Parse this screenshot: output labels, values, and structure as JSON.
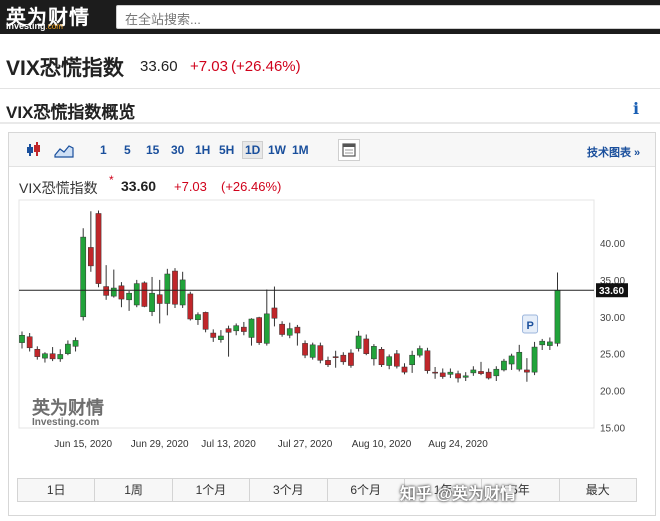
{
  "header": {
    "logo_cn": "英为财情",
    "logo_en": "Investing",
    "logo_en_suffix": ".com",
    "search_placeholder": "在全站搜索..."
  },
  "instrument": {
    "name": "VIX恐慌指数",
    "price": "33.60",
    "change": "+7.03",
    "change_pct": "(+26.46%)"
  },
  "section": {
    "title": "VIX恐慌指数概览",
    "info_icon": "i"
  },
  "toolbar": {
    "intervals": [
      "1",
      "5",
      "15",
      "30",
      "1H",
      "5H",
      "1D",
      "1W",
      "1M"
    ],
    "active_interval": "1D",
    "tech_chart_label": "技术图表 »"
  },
  "chart_header": {
    "name": "VIX恐慌指数",
    "star": "*",
    "price": "33.60",
    "change": "+7.03",
    "change_pct": "(+26.46%)"
  },
  "chart_data": {
    "type": "candlestick",
    "title": "VIX恐慌指数",
    "x_labels": [
      "Jun 15, 2020",
      "Jun 29, 2020",
      "Jul 13, 2020",
      "Jul 27, 2020",
      "Aug 10, 2020",
      "Aug 24, 2020"
    ],
    "y_ticks": [
      "15.00",
      "20.00",
      "25.00",
      "30.00",
      "35.00",
      "40.00"
    ],
    "ylim": [
      15,
      42
    ],
    "current_price_label": "33.60",
    "marker_label": "P",
    "up_color": "#21a33a",
    "down_color": "#c0262a",
    "candles": [
      {
        "date": "2020-06-03",
        "o": 26.5,
        "h": 28.0,
        "l": 25.7,
        "c": 27.5
      },
      {
        "date": "2020-06-04",
        "o": 27.3,
        "h": 27.8,
        "l": 25.3,
        "c": 25.8
      },
      {
        "date": "2020-06-05",
        "o": 25.6,
        "h": 26.0,
        "l": 24.2,
        "c": 24.6
      },
      {
        "date": "2020-06-08",
        "o": 24.4,
        "h": 25.2,
        "l": 23.8,
        "c": 25.0
      },
      {
        "date": "2020-06-09",
        "o": 25.0,
        "h": 25.9,
        "l": 24.0,
        "c": 24.3
      },
      {
        "date": "2020-06-10",
        "o": 24.3,
        "h": 25.6,
        "l": 23.9,
        "c": 24.9
      },
      {
        "date": "2020-06-11",
        "o": 25.0,
        "h": 26.8,
        "l": 24.8,
        "c": 26.3
      },
      {
        "date": "2020-06-12",
        "o": 26.0,
        "h": 27.2,
        "l": 25.3,
        "c": 26.8
      },
      {
        "date": "2020-06-15",
        "o": 30.0,
        "h": 42.0,
        "l": 29.5,
        "c": 40.8
      },
      {
        "date": "2020-06-16",
        "o": 39.4,
        "h": 44.3,
        "l": 36.1,
        "c": 36.9
      },
      {
        "date": "2020-06-17",
        "o": 44.0,
        "h": 44.4,
        "l": 34.0,
        "c": 34.5
      },
      {
        "date": "2020-06-18",
        "o": 34.1,
        "h": 37.0,
        "l": 32.3,
        "c": 32.9
      },
      {
        "date": "2020-06-19",
        "o": 32.8,
        "h": 36.4,
        "l": 32.6,
        "c": 33.9
      },
      {
        "date": "2020-06-22",
        "o": 34.2,
        "h": 34.7,
        "l": 31.3,
        "c": 32.4
      },
      {
        "date": "2020-06-23",
        "o": 32.3,
        "h": 33.5,
        "l": 30.8,
        "c": 33.2
      },
      {
        "date": "2020-06-24",
        "o": 31.6,
        "h": 35.0,
        "l": 31.3,
        "c": 34.5
      },
      {
        "date": "2020-06-25",
        "o": 34.6,
        "h": 34.8,
        "l": 31.3,
        "c": 31.4
      },
      {
        "date": "2020-06-26",
        "o": 30.7,
        "h": 35.4,
        "l": 30.1,
        "c": 33.2
      },
      {
        "date": "2020-06-29",
        "o": 33.0,
        "h": 35.0,
        "l": 29.1,
        "c": 31.8
      },
      {
        "date": "2020-06-30",
        "o": 31.8,
        "h": 36.5,
        "l": 30.2,
        "c": 35.8
      },
      {
        "date": "2020-07-01",
        "o": 36.2,
        "h": 36.6,
        "l": 31.2,
        "c": 31.7
      },
      {
        "date": "2020-07-02",
        "o": 31.6,
        "h": 36.1,
        "l": 31.2,
        "c": 35.0
      },
      {
        "date": "2020-07-06",
        "o": 33.1,
        "h": 33.4,
        "l": 29.5,
        "c": 29.7
      },
      {
        "date": "2020-07-07",
        "o": 29.6,
        "h": 30.6,
        "l": 28.9,
        "c": 30.3
      },
      {
        "date": "2020-07-08",
        "o": 30.6,
        "h": 30.7,
        "l": 27.9,
        "c": 28.3
      },
      {
        "date": "2020-07-09",
        "o": 27.8,
        "h": 28.3,
        "l": 26.6,
        "c": 27.2
      },
      {
        "date": "2020-07-10",
        "o": 26.9,
        "h": 28.2,
        "l": 26.5,
        "c": 27.4
      },
      {
        "date": "2020-07-13",
        "o": 28.4,
        "h": 28.8,
        "l": 24.6,
        "c": 27.9
      },
      {
        "date": "2020-07-14",
        "o": 28.1,
        "h": 29.1,
        "l": 27.5,
        "c": 28.8
      },
      {
        "date": "2020-07-15",
        "o": 28.6,
        "h": 29.3,
        "l": 27.5,
        "c": 28.0
      },
      {
        "date": "2020-07-16",
        "o": 27.2,
        "h": 29.8,
        "l": 26.1,
        "c": 29.7
      },
      {
        "date": "2020-07-17",
        "o": 29.9,
        "h": 30.0,
        "l": 26.2,
        "c": 26.5
      },
      {
        "date": "2020-07-20",
        "o": 26.4,
        "h": 33.7,
        "l": 26.1,
        "c": 30.4
      },
      {
        "date": "2020-07-21",
        "o": 31.2,
        "h": 34.1,
        "l": 28.7,
        "c": 29.8
      },
      {
        "date": "2020-07-22",
        "o": 29.0,
        "h": 29.4,
        "l": 27.3,
        "c": 27.6
      },
      {
        "date": "2020-07-23",
        "o": 27.5,
        "h": 29.2,
        "l": 27.1,
        "c": 28.4
      },
      {
        "date": "2020-07-24",
        "o": 28.6,
        "h": 28.9,
        "l": 26.1,
        "c": 27.8
      },
      {
        "date": "2020-07-27",
        "o": 26.4,
        "h": 26.8,
        "l": 24.4,
        "c": 24.8
      },
      {
        "date": "2020-07-28",
        "o": 24.5,
        "h": 26.5,
        "l": 24.2,
        "c": 26.2
      },
      {
        "date": "2020-07-29",
        "o": 26.1,
        "h": 26.5,
        "l": 23.7,
        "c": 24.1
      },
      {
        "date": "2020-07-30",
        "o": 24.1,
        "h": 24.6,
        "l": 23.2,
        "c": 23.5
      },
      {
        "date": "2020-07-31",
        "o": 24.6,
        "h": 25.4,
        "l": 23.1,
        "c": 24.5
      },
      {
        "date": "2020-08-03",
        "o": 24.8,
        "h": 25.2,
        "l": 23.5,
        "c": 23.9
      },
      {
        "date": "2020-08-04",
        "o": 25.1,
        "h": 25.6,
        "l": 23.1,
        "c": 23.4
      },
      {
        "date": "2020-08-05",
        "o": 25.7,
        "h": 28.1,
        "l": 25.3,
        "c": 27.4
      },
      {
        "date": "2020-08-06",
        "o": 27.0,
        "h": 27.6,
        "l": 24.8,
        "c": 25.0
      },
      {
        "date": "2020-08-07",
        "o": 24.3,
        "h": 26.3,
        "l": 23.4,
        "c": 26.0
      },
      {
        "date": "2020-08-10",
        "o": 25.6,
        "h": 25.9,
        "l": 23.2,
        "c": 23.5
      },
      {
        "date": "2020-08-11",
        "o": 23.4,
        "h": 24.9,
        "l": 22.9,
        "c": 24.6
      },
      {
        "date": "2020-08-12",
        "o": 25.0,
        "h": 25.5,
        "l": 23.0,
        "c": 23.3
      },
      {
        "date": "2020-08-13",
        "o": 23.2,
        "h": 23.7,
        "l": 22.2,
        "c": 22.5
      },
      {
        "date": "2020-08-14",
        "o": 23.5,
        "h": 25.4,
        "l": 22.4,
        "c": 24.8
      },
      {
        "date": "2020-08-17",
        "o": 24.8,
        "h": 26.1,
        "l": 24.5,
        "c": 25.7
      },
      {
        "date": "2020-08-18",
        "o": 25.4,
        "h": 25.8,
        "l": 22.3,
        "c": 22.7
      },
      {
        "date": "2020-08-19",
        "o": 22.5,
        "h": 23.2,
        "l": 21.6,
        "c": 22.4
      },
      {
        "date": "2020-08-20",
        "o": 22.4,
        "h": 23.0,
        "l": 21.6,
        "c": 21.9
      },
      {
        "date": "2020-08-21",
        "o": 22.2,
        "h": 23.0,
        "l": 21.7,
        "c": 22.5
      },
      {
        "date": "2020-08-24",
        "o": 22.3,
        "h": 22.7,
        "l": 21.1,
        "c": 21.7
      },
      {
        "date": "2020-08-25",
        "o": 21.8,
        "h": 22.5,
        "l": 21.3,
        "c": 22.0
      },
      {
        "date": "2020-08-26",
        "o": 22.4,
        "h": 23.3,
        "l": 22.0,
        "c": 22.8
      },
      {
        "date": "2020-08-27",
        "o": 22.6,
        "h": 23.9,
        "l": 22.1,
        "c": 22.3
      },
      {
        "date": "2020-08-28",
        "o": 22.5,
        "h": 23.0,
        "l": 21.5,
        "c": 21.7
      },
      {
        "date": "2020-08-31",
        "o": 22.0,
        "h": 23.3,
        "l": 21.3,
        "c": 22.9
      },
      {
        "date": "2020-09-01",
        "o": 22.8,
        "h": 24.3,
        "l": 22.6,
        "c": 24.0
      },
      {
        "date": "2020-09-02",
        "o": 23.6,
        "h": 25.0,
        "l": 22.8,
        "c": 24.7
      },
      {
        "date": "2020-09-03",
        "o": 22.9,
        "h": 26.2,
        "l": 22.6,
        "c": 25.2
      },
      {
        "date": "2020-09-04",
        "o": 22.8,
        "h": 24.4,
        "l": 21.2,
        "c": 22.5
      },
      {
        "date": "2020-09-08",
        "o": 22.5,
        "h": 26.6,
        "l": 22.1,
        "c": 25.9
      },
      {
        "date": "2020-09-09",
        "o": 26.2,
        "h": 27.0,
        "l": 25.5,
        "c": 26.7
      },
      {
        "date": "2020-09-10",
        "o": 26.1,
        "h": 27.2,
        "l": 25.5,
        "c": 26.6
      },
      {
        "date": "2020-09-11",
        "o": 26.4,
        "h": 36.0,
        "l": 26.0,
        "c": 33.6
      }
    ]
  },
  "ranges": [
    "1日",
    "1周",
    "1个月",
    "3个月",
    "6个月",
    "1年",
    "5年",
    "最大"
  ],
  "overlay_text": "知乎 @英为财情",
  "watermark_cn": "英为财情",
  "watermark_en": "Investing.com"
}
